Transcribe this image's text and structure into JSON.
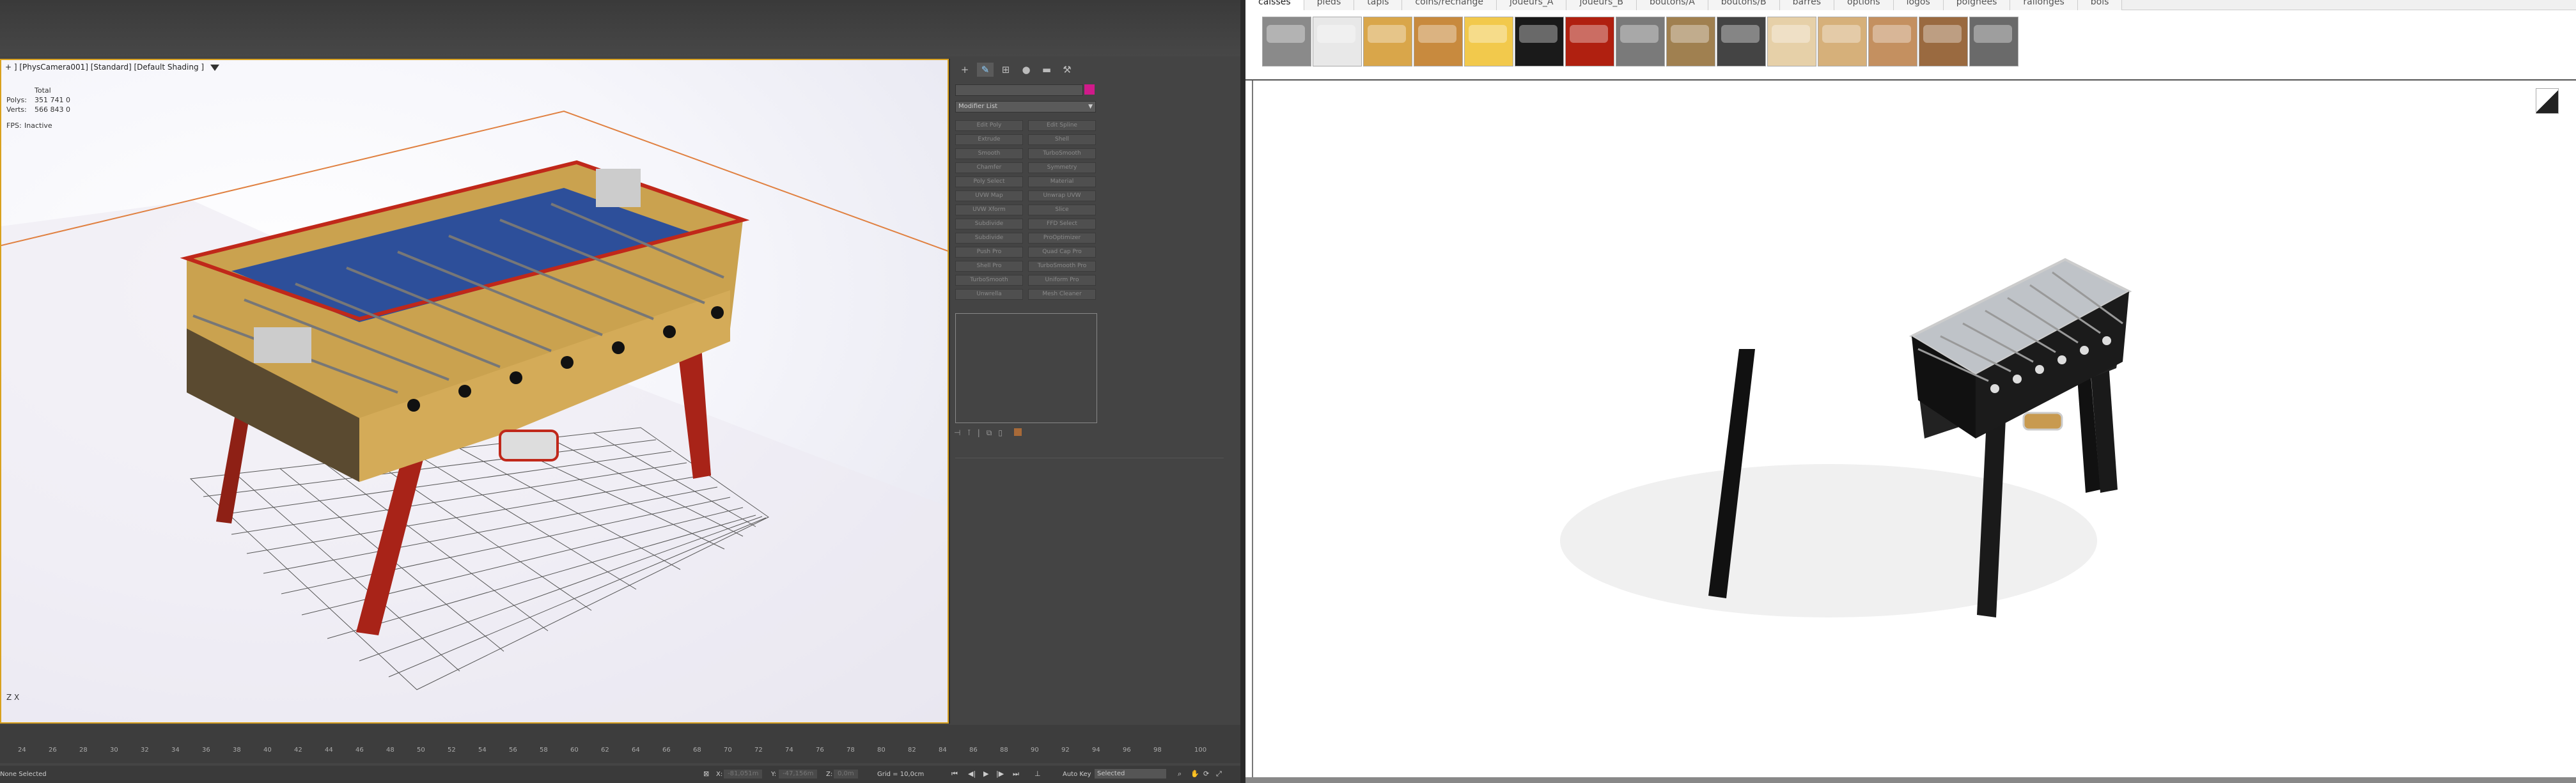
{
  "viewport": {
    "label": "+ ] [PhysCamera001] [Standard] [Default Shading ]",
    "stats": {
      "header": "Total",
      "rows": [
        {
          "label": "Polys:",
          "value": "351 741",
          "extra": "0"
        },
        {
          "label": "Verts:",
          "value": "566 843",
          "extra": "0"
        }
      ],
      "fps_label": "FPS:",
      "fps_value": "Inactive"
    },
    "axis": "Z X"
  },
  "command_panel": {
    "modifier_list_label": "Modifier List",
    "modifiers": [
      "Edit Poly",
      "Edit Spline",
      "Extrude",
      "Shell",
      "Smooth",
      "TurboSmooth",
      "Chamfer",
      "Symmetry",
      "Poly Select",
      "Material",
      "UVW Map",
      "Unwrap UVW",
      "UVW Xform",
      "Slice",
      "Subdivide",
      "FFD Select",
      "Subdivide",
      "ProOptimizer",
      "Push Pro",
      "Quad Cap Pro",
      "Shell Pro",
      "TurboSmooth Pro",
      "TurboSmooth",
      "Uniform Pro",
      "Unwrella",
      "Mesh Cleaner"
    ]
  },
  "timeline": {
    "ticks": [
      "24",
      "26",
      "28",
      "30",
      "32",
      "34",
      "36",
      "38",
      "40",
      "42",
      "44",
      "46",
      "48",
      "50",
      "52",
      "54",
      "56",
      "58",
      "60",
      "62",
      "64",
      "66",
      "68",
      "70",
      "72",
      "74",
      "76",
      "78",
      "80",
      "82",
      "84",
      "86",
      "88",
      "90",
      "92",
      "94",
      "96",
      "98",
      "100"
    ]
  },
  "status": {
    "selection": "None Selected",
    "x_label": "X:",
    "x_value": "-81,051m",
    "y_label": "Y:",
    "y_value": "-47,156m",
    "z_label": "Z:",
    "z_value": "0,0m",
    "grid": "Grid = 10,0cm",
    "auto_key": "Auto Key",
    "selected": "Selected"
  },
  "configurator": {
    "tabs": [
      "caisses",
      "pieds",
      "tapis",
      "coins/rechange",
      "joueurs_A",
      "joueurs_B",
      "boutons/A",
      "boutons/B",
      "barres",
      "options",
      "logos",
      "poignées",
      "rallonges",
      "bois"
    ],
    "swatch_colors": [
      "#8a8a8a",
      "#e8e8e8",
      "#d9a64a",
      "#c88a3e",
      "#f2c94c",
      "#1a1a1a",
      "#b02010",
      "#7a7a7a",
      "#a08050",
      "#444444",
      "#e6d0a8",
      "#d6b07a",
      "#c49060",
      "#9a6a40",
      "#6a6a6a"
    ]
  }
}
